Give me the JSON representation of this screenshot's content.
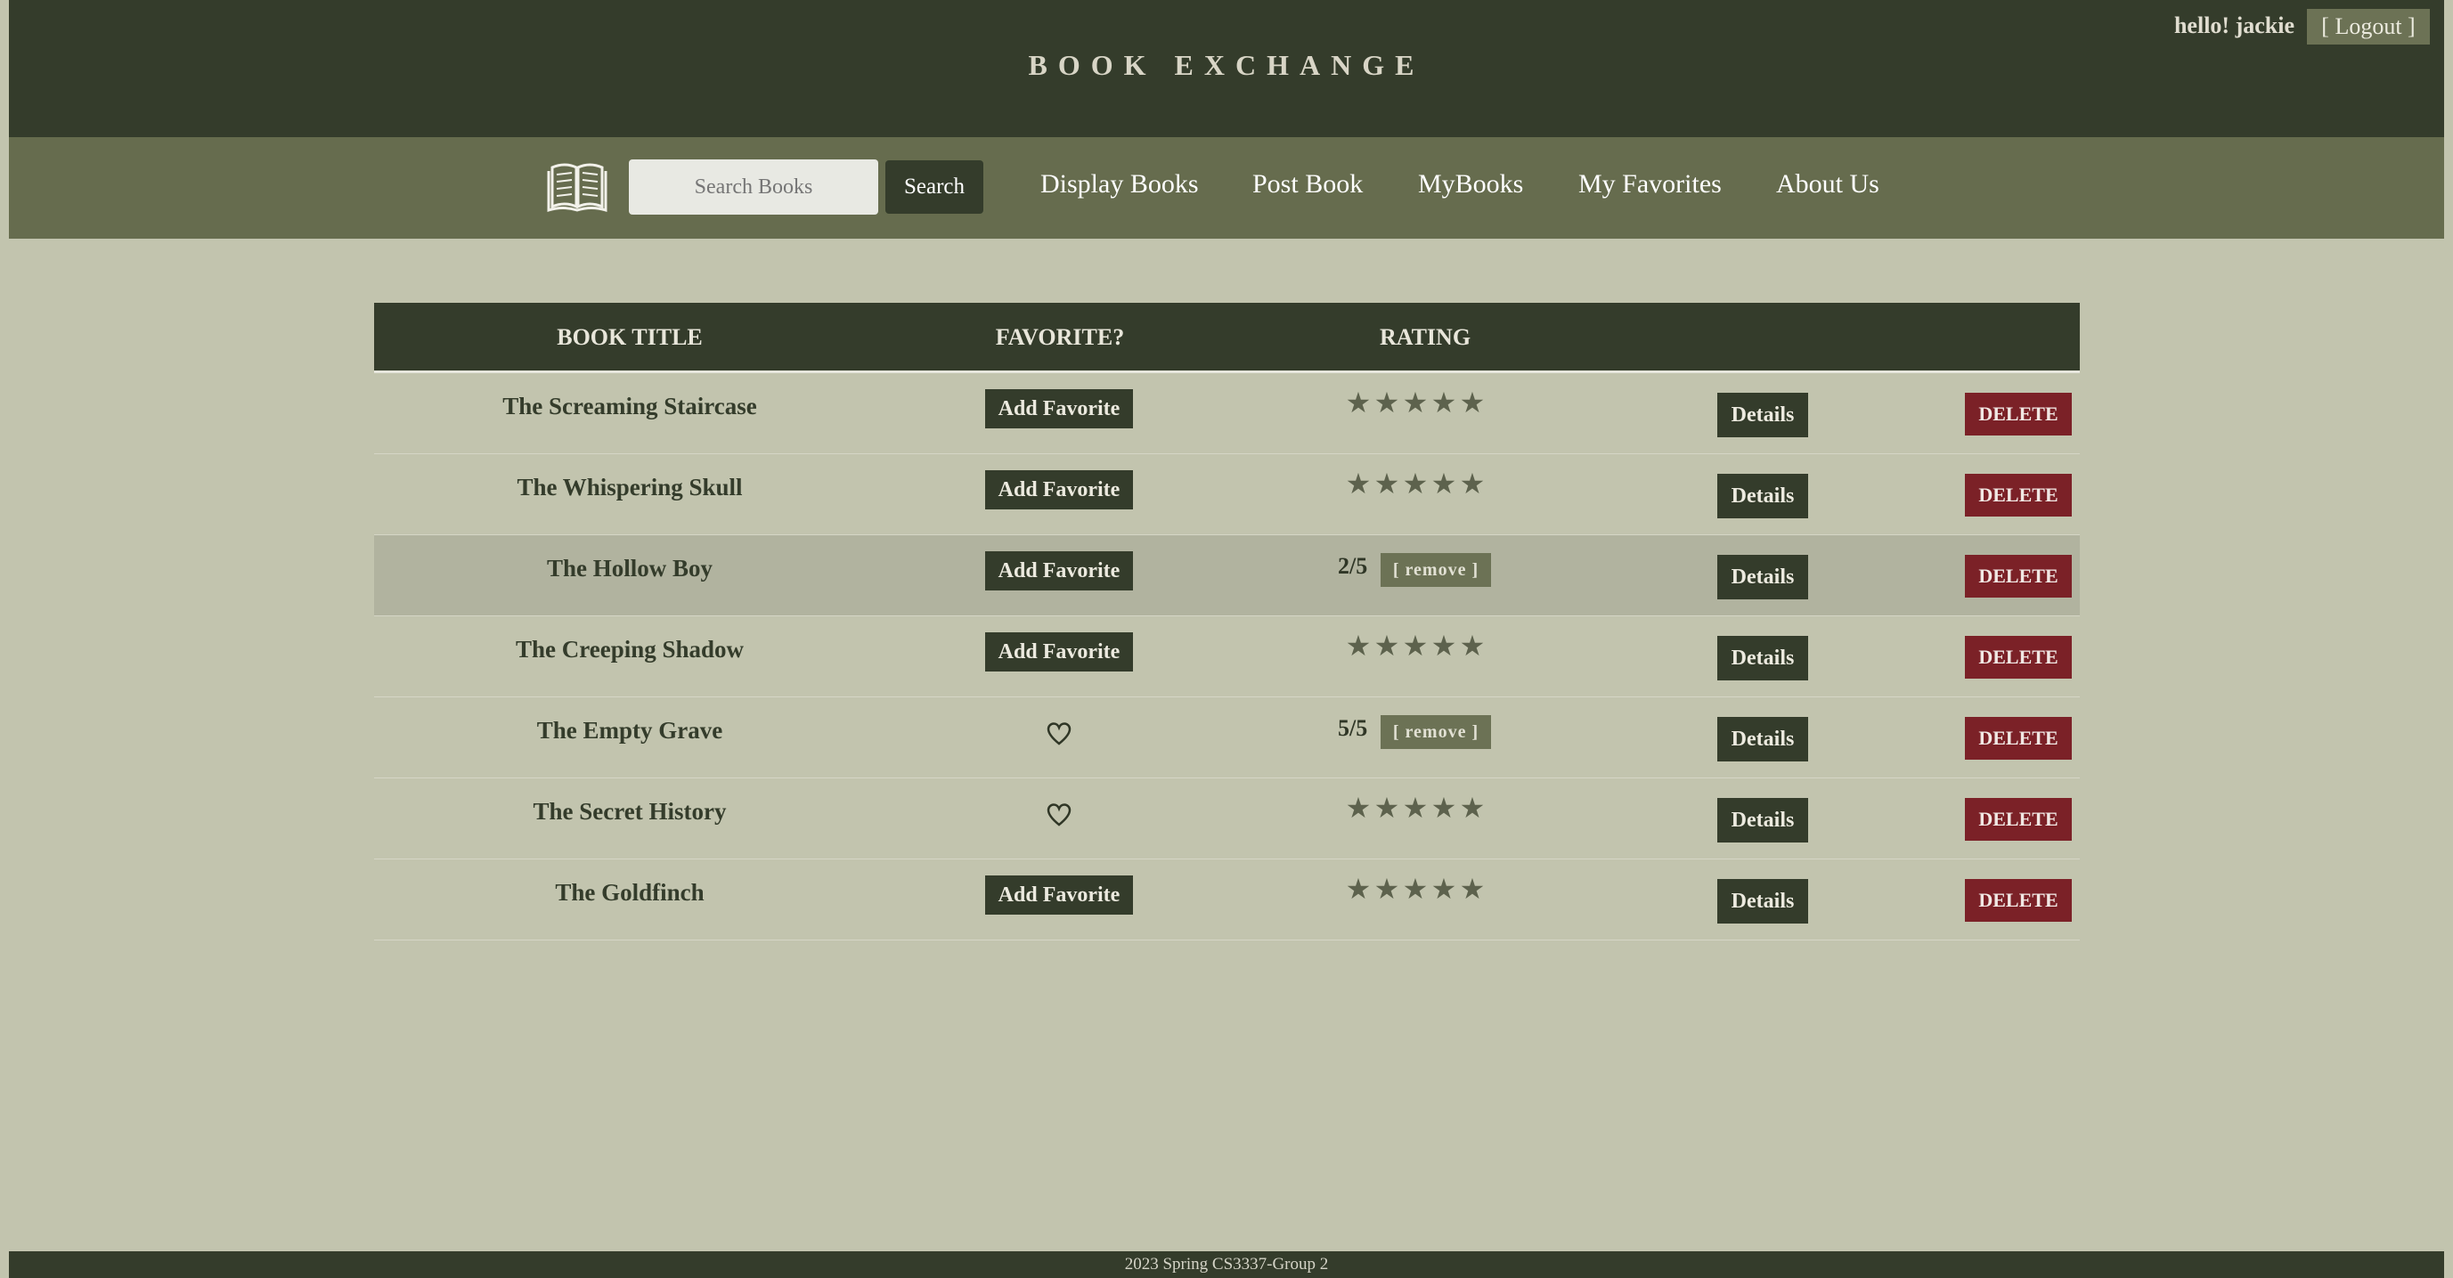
{
  "header": {
    "title": "BOOK EXCHANGE",
    "greeting": "hello! jackie",
    "logout_label": "[ Logout ]"
  },
  "nav": {
    "logo_icon": "open-book-icon",
    "search_placeholder": "Search Books",
    "search_label": "Search",
    "links": [
      "Display Books",
      "Post Book",
      "MyBooks",
      "My Favorites",
      "About Us"
    ]
  },
  "table": {
    "headers": [
      "BOOK TITLE",
      "FAVORITE?",
      "RATING",
      "",
      ""
    ],
    "add_favorite_label": "Add Favorite",
    "remove_label": "[ remove ]",
    "details_label": "Details",
    "delete_label": "DELETE",
    "star_glyph": "★",
    "heart_icon": "heart-outline-icon",
    "rows": [
      {
        "title": "The Screaming Staircase",
        "favorite": false,
        "rating": null
      },
      {
        "title": "The Whispering Skull",
        "favorite": false,
        "rating": null
      },
      {
        "title": "The Hollow Boy",
        "favorite": false,
        "rating": "2/5",
        "highlighted": true
      },
      {
        "title": "The Creeping Shadow",
        "favorite": false,
        "rating": null
      },
      {
        "title": "The Empty Grave",
        "favorite": true,
        "rating": "5/5"
      },
      {
        "title": "The Secret History",
        "favorite": true,
        "rating": null
      },
      {
        "title": "The Goldfinch",
        "favorite": false,
        "rating": null
      }
    ]
  },
  "footer": {
    "text": "2023 Spring CS3337-Group 2"
  },
  "colors": {
    "dark_green": "#343c2b",
    "nav_green": "#666c4e",
    "background": "#c2c4ae",
    "delete_red": "#7b2127"
  }
}
